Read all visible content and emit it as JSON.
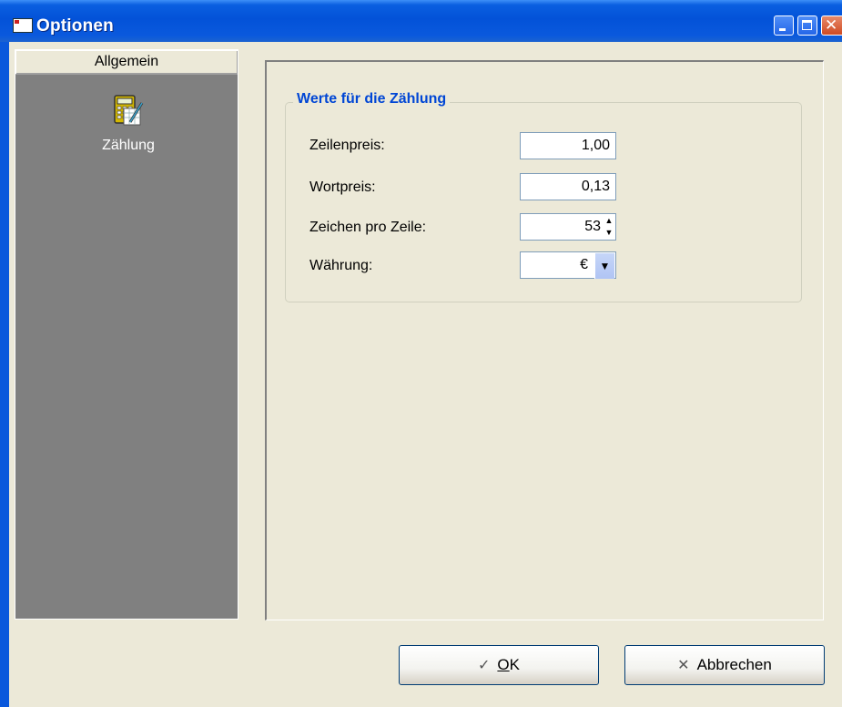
{
  "window": {
    "title": "Optionen",
    "app_icon_text": "ѐ"
  },
  "sidebar": {
    "header": "Allgemein",
    "items": [
      {
        "label": "Zählung",
        "icon": "calculator-icon"
      }
    ]
  },
  "group": {
    "title": "Werte für die Zählung",
    "fields": [
      {
        "label": "Zeilenpreis:",
        "value": "1,00"
      },
      {
        "label": "Wortpreis:",
        "value": "0,13"
      },
      {
        "label": "Zeichen pro Zeile:",
        "value": "53"
      },
      {
        "label": "Währung:",
        "value": "€"
      }
    ]
  },
  "buttons": {
    "ok_mnemonic": "O",
    "ok_rest": "K",
    "cancel_label": "Abbrechen"
  },
  "colors": {
    "titlebar": "#0352d8",
    "group_title": "#0046d5",
    "sidebar_bg": "#808080",
    "window_bg": "#ece9d8"
  }
}
